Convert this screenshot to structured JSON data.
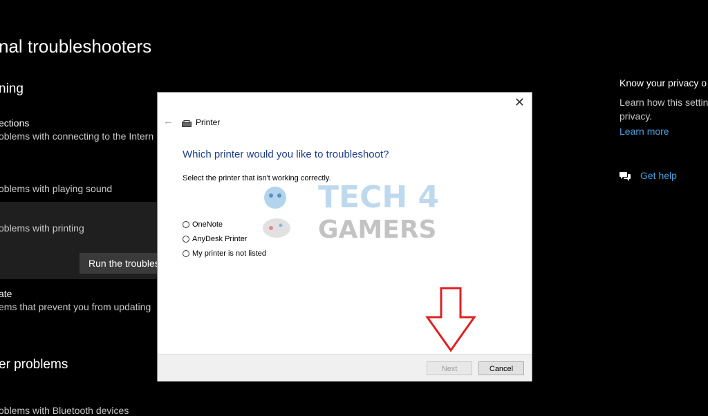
{
  "background": {
    "page_title": "nal troubleshooters",
    "section_getting_running": "ning",
    "items": [
      {
        "title": "ections",
        "desc": "oblems with connecting to the Intern"
      },
      {
        "title": "",
        "desc": "oblems with playing sound"
      },
      {
        "title": "",
        "desc": "oblems with printing"
      },
      {
        "title": "ate",
        "desc": "ems that prevent you from updating"
      },
      {
        "title": "",
        "desc": "oblems with Bluetooth devices"
      }
    ],
    "run_button": "Run the troubleshooter",
    "section_other": "er problems",
    "sidebar": {
      "privacy_title": "Know your privacy o",
      "privacy_desc": "Learn how this settin privacy.",
      "learn_more": "Learn more",
      "get_help": "Get help"
    }
  },
  "dialog": {
    "app_title": "Printer",
    "heading": "Which printer would you like to troubleshoot?",
    "instruction": "Select the printer that isn't working correctly.",
    "options": [
      "OneNote",
      "AnyDesk Printer",
      "My printer is not listed"
    ],
    "next_label": "Next",
    "cancel_label": "Cancel",
    "close_glyph": "✕",
    "back_glyph": "←"
  },
  "watermark": {
    "line1": "TECH 4",
    "line2": "GAMERS"
  },
  "colors": {
    "accent_link": "#4ca0e0",
    "heading_blue": "#1e3e8a",
    "arrow_red": "#e02020"
  }
}
